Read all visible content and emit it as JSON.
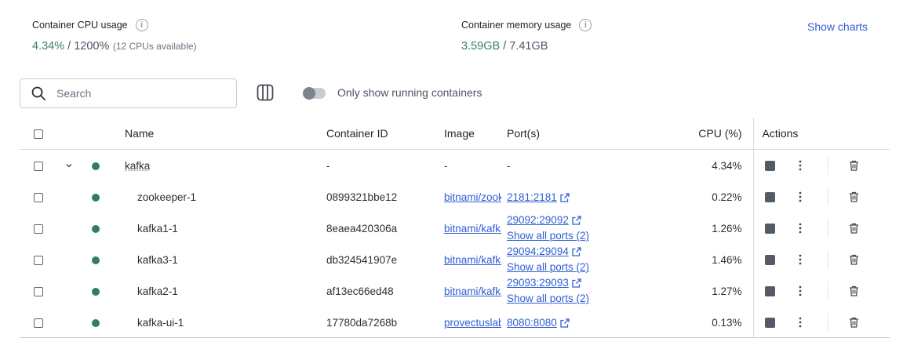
{
  "stats": {
    "cpu": {
      "label": "Container CPU usage",
      "value_used": "4.34%",
      "value_rest": " / 1200%",
      "note": "(12 CPUs available)"
    },
    "memory": {
      "label": "Container memory usage",
      "value_used": "3.59GB",
      "value_rest": " / 7.41GB"
    },
    "show_charts": "Show charts"
  },
  "toolbar": {
    "search_placeholder": "Search",
    "toggle_label": "Only show running containers",
    "toggle_on": false
  },
  "table": {
    "headers": {
      "name": "Name",
      "container_id": "Container ID",
      "image": "Image",
      "ports": "Port(s)",
      "cpu": "CPU (%)",
      "actions": "Actions"
    },
    "rows": [
      {
        "name": "kafka",
        "id": "-",
        "image": "-",
        "port": "-",
        "show_all": "",
        "cpu": "4.34%"
      },
      {
        "name": "zookeeper-1",
        "id": "0899321bbe12",
        "image": "bitnami/zookeeper",
        "port": "2181:2181",
        "show_all": "",
        "cpu": "0.22%"
      },
      {
        "name": "kafka1-1",
        "id": "8eaea420306a",
        "image": "bitnami/kafka",
        "port": "29092:29092",
        "show_all": "Show all ports (2)",
        "cpu": "1.26%"
      },
      {
        "name": "kafka3-1",
        "id": "db324541907e",
        "image": "bitnami/kafka",
        "port": "29094:29094",
        "show_all": "Show all ports (2)",
        "cpu": "1.46%"
      },
      {
        "name": "kafka2-1",
        "id": "af13ec66ed48",
        "image": "bitnami/kafka",
        "port": "29093:29093",
        "show_all": "Show all ports (2)",
        "cpu": "1.27%"
      },
      {
        "name": "kafka-ui-1",
        "id": "17780da7268b",
        "image": "provectuslabs/kafka-ui",
        "port": "8080:8080",
        "show_all": "",
        "cpu": "0.13%"
      }
    ]
  },
  "colors": {
    "accent": "#2f5fd3",
    "running": "#2f7d65",
    "usage_green": "#3a7f6a"
  },
  "icons": [
    "info-icon",
    "search-icon",
    "columns-icon",
    "chevron-down-icon",
    "status-dot-icon",
    "external-link-icon",
    "stop-icon",
    "more-vertical-icon",
    "trash-icon"
  ]
}
